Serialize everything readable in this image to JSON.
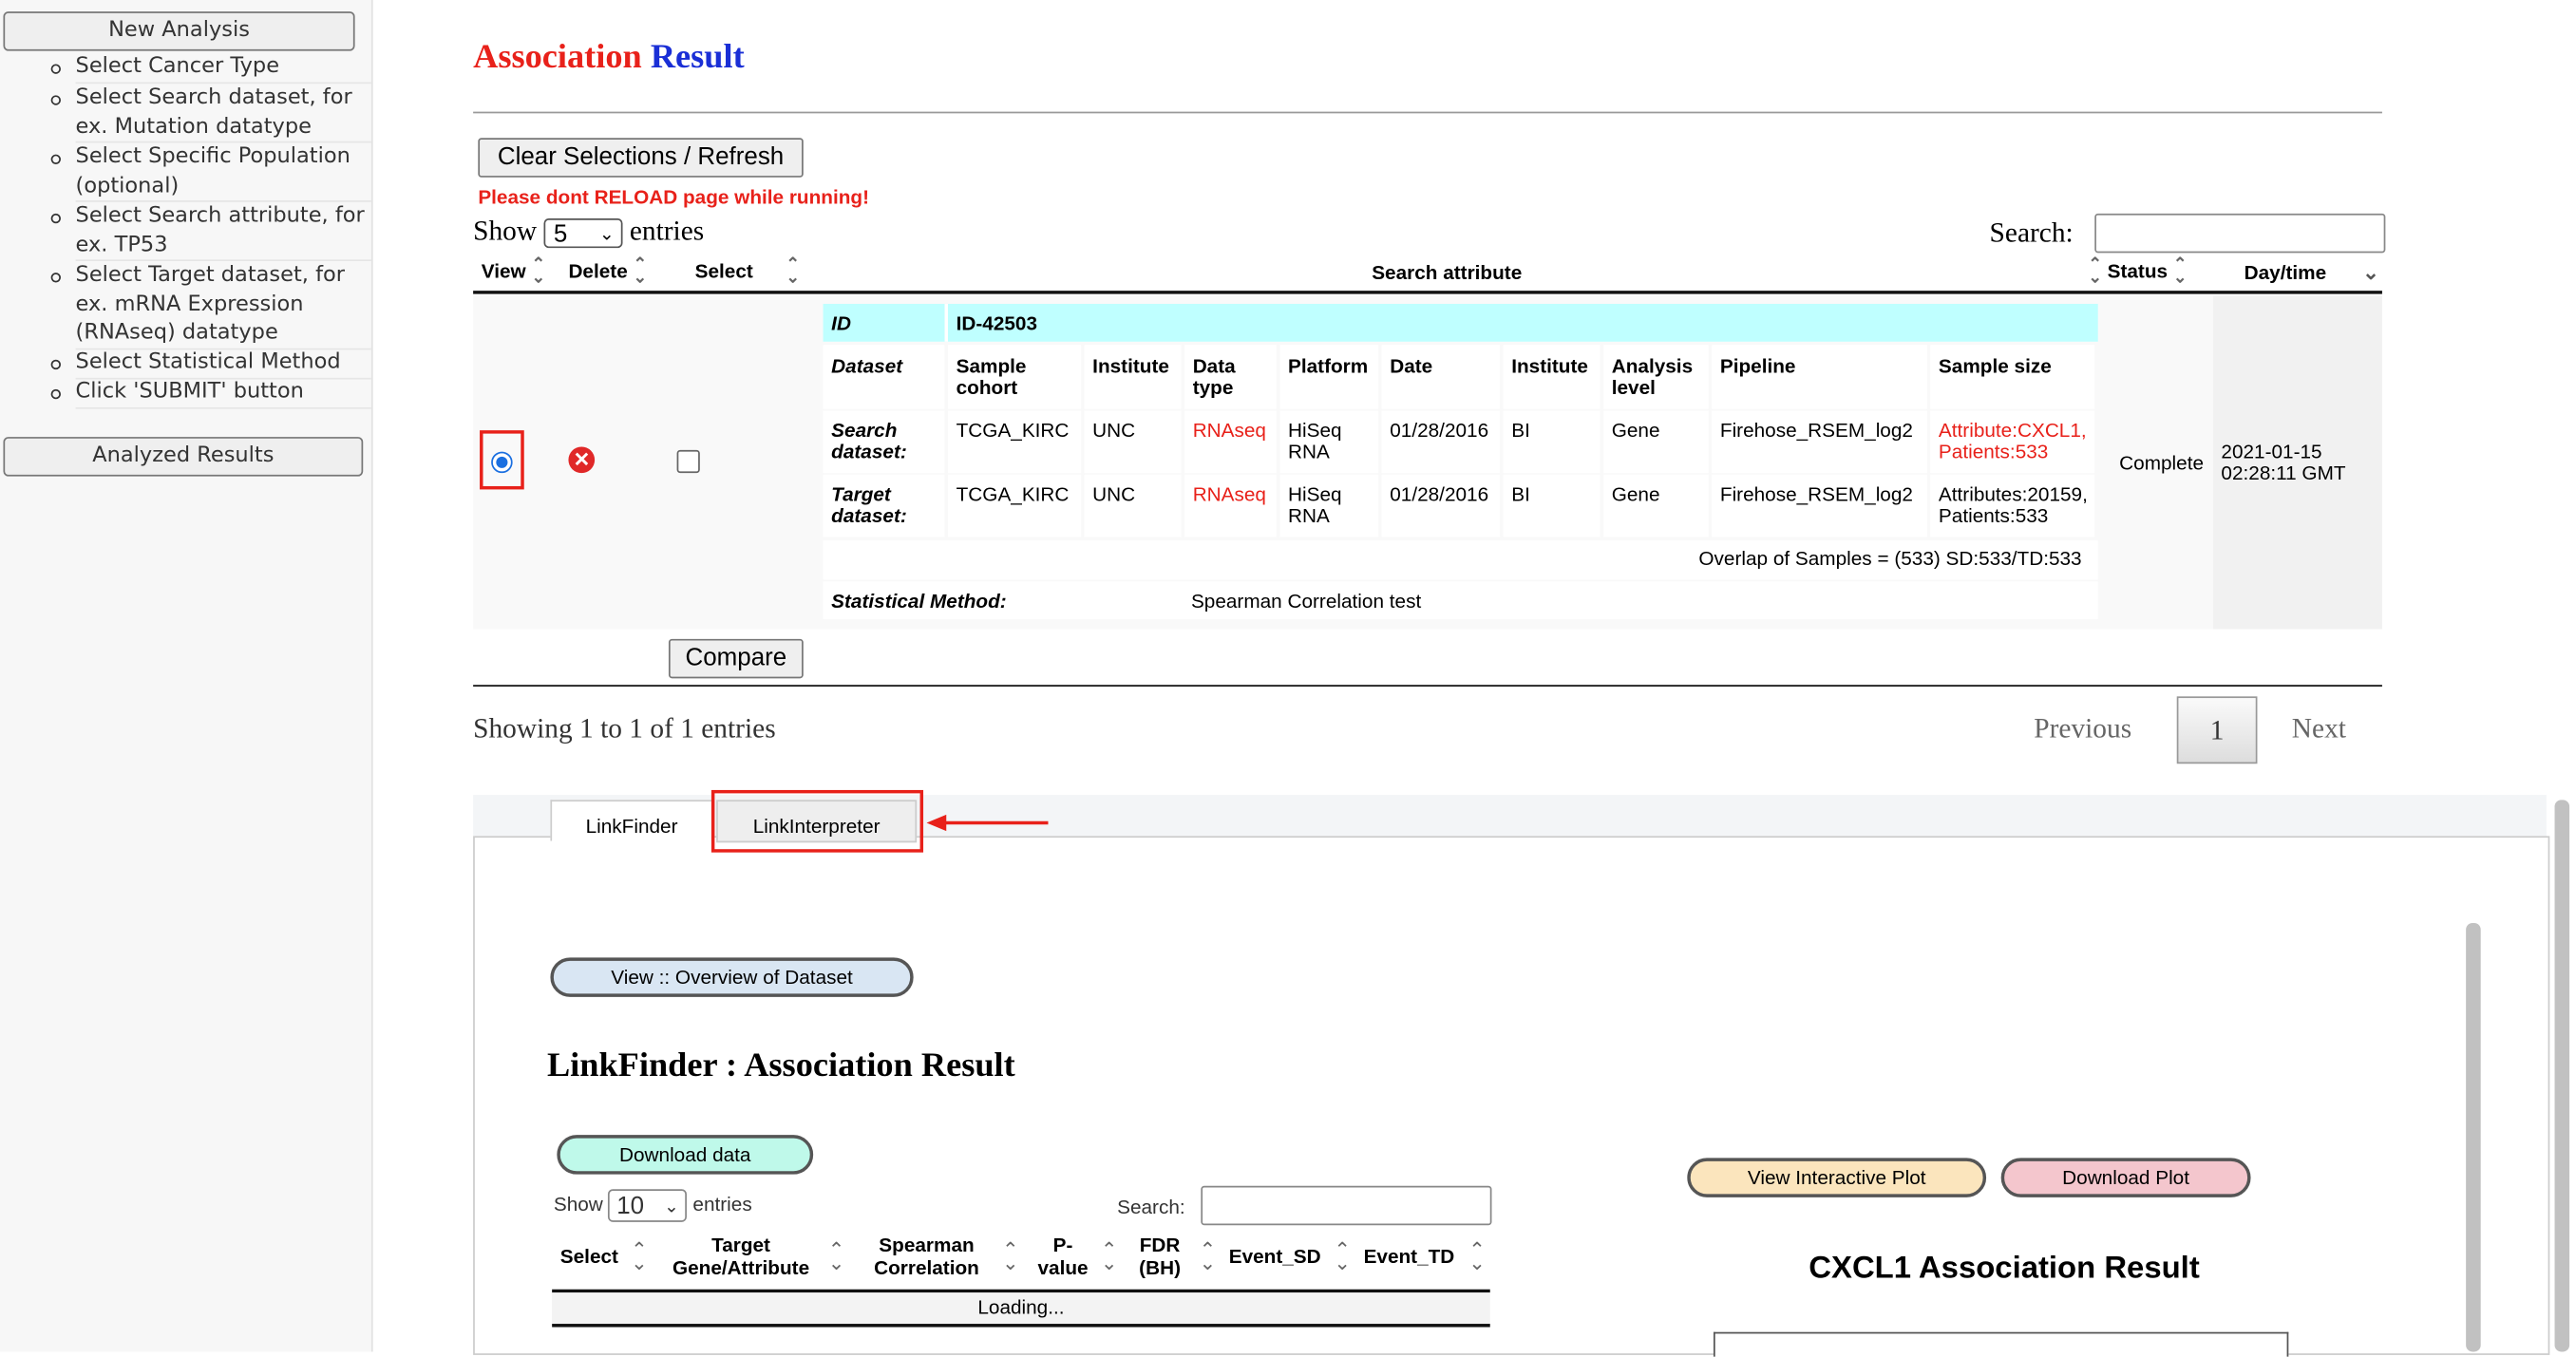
{
  "sidebar": {
    "new_analysis": "New Analysis",
    "steps": [
      "Select Cancer Type",
      "Select Search dataset, for ex. Mutation datatype",
      "Select Specific Population (optional)",
      "Select Search attribute, for ex. TP53",
      "Select Target dataset, for ex. mRNA Expression (RNAseq) datatype",
      "Select Statistical Method",
      "Click 'SUBMIT' button"
    ],
    "analyzed_results": "Analyzed Results"
  },
  "header": {
    "title_part1": "Association",
    "title_part2": "Result",
    "title_colors": [
      "#e8211a",
      "#1a2fd6"
    ]
  },
  "toolbar": {
    "clear_label": "Clear Selections / Refresh",
    "warning": "Please dont RELOAD page while running!",
    "show": "Show",
    "entries_value": "5",
    "entries": "entries",
    "search_label": "Search:",
    "search_value": ""
  },
  "columns": {
    "view": "View",
    "delete": "Delete",
    "select": "Select",
    "search_attribute": "Search attribute",
    "status": "Status",
    "daytime": "Day/time"
  },
  "row": {
    "id_label": "ID",
    "id_value": "ID-42503",
    "headers": [
      "Dataset",
      "Sample cohort",
      "Institute",
      "Data type",
      "Platform",
      "Date",
      "Institute",
      "Analysis level",
      "Pipeline",
      "Sample size"
    ],
    "search": [
      "Search dataset:",
      "TCGA_KIRC",
      "UNC",
      "RNAseq",
      "HiSeq RNA",
      "01/28/2016",
      "BI",
      "Gene",
      "Firehose_RSEM_log2",
      "Attribute:CXCL1, Patients:533"
    ],
    "target": [
      "Target dataset:",
      "TCGA_KIRC",
      "UNC",
      "RNAseq",
      "HiSeq RNA",
      "01/28/2016",
      "BI",
      "Gene",
      "Firehose_RSEM_log2",
      "Attributes:20159, Patients:533"
    ],
    "overlap": "Overlap of Samples = (533) SD:533/TD:533",
    "method_label": "Statistical Method:",
    "method_value": "Spearman Correlation test",
    "status": "Complete",
    "daytime": "2021-01-15 02:28:11 GMT",
    "view_selected": true,
    "select_checked": false
  },
  "compare_label": "Compare",
  "pagination": {
    "info": "Showing 1 to 1 of 1 entries",
    "previous": "Previous",
    "page": "1",
    "next": "Next"
  },
  "tabs": [
    {
      "label": "LinkFinder",
      "active": true
    },
    {
      "label": "LinkInterpreter",
      "active": false
    }
  ],
  "panel": {
    "overview_btn": "View :: Overview of Dataset",
    "title": "LinkFinder : Association Result",
    "download_data": "Download data",
    "show": "Show",
    "entries_value": "10",
    "entries": "entries",
    "search_label": "Search:",
    "columns": [
      "Select",
      "Target Gene/Attribute",
      "Spearman Correlation",
      "P-value",
      "FDR (BH)",
      "Event_SD",
      "Event_TD"
    ],
    "loading": "Loading...",
    "view_plot": "View Interactive Plot",
    "download_plot": "Download Plot",
    "plot_title": "CXCL1 Association Result"
  },
  "colors": {
    "highlight": "#e8211a",
    "id_row": "#bfffff",
    "download_data": "#bff9ea",
    "view_plot": "#fbe5bd",
    "download_plot": "#f4c6cd",
    "overview": "#d9e6f3"
  }
}
